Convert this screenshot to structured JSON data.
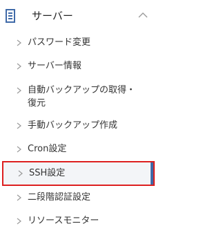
{
  "sidebar": {
    "section": {
      "title": "サーバー",
      "icon": "server-icon",
      "toggle_icon": "chevron-up-icon",
      "expanded": true
    },
    "items": [
      {
        "label": "パスワード変更",
        "icon": "chevron-right-icon"
      },
      {
        "label": "サーバー情報",
        "icon": "chevron-right-icon"
      },
      {
        "label_line1": "自動バックアップの取得・",
        "label_line2": "復元",
        "icon": "chevron-right-icon"
      },
      {
        "label": "手動バックアップ作成",
        "icon": "chevron-right-icon"
      },
      {
        "label": "Cron設定",
        "icon": "chevron-right-icon"
      },
      {
        "label": "SSH設定",
        "icon": "chevron-right-icon",
        "selected": true
      },
      {
        "label": "二段階認証設定",
        "icon": "chevron-right-icon"
      },
      {
        "label": "リソースモニター",
        "icon": "chevron-right-icon"
      }
    ]
  },
  "colors": {
    "accent": "#3f6aa8",
    "highlight_border": "#dd1f1f",
    "text": "#333333",
    "chevron": "#9a9a9a"
  }
}
